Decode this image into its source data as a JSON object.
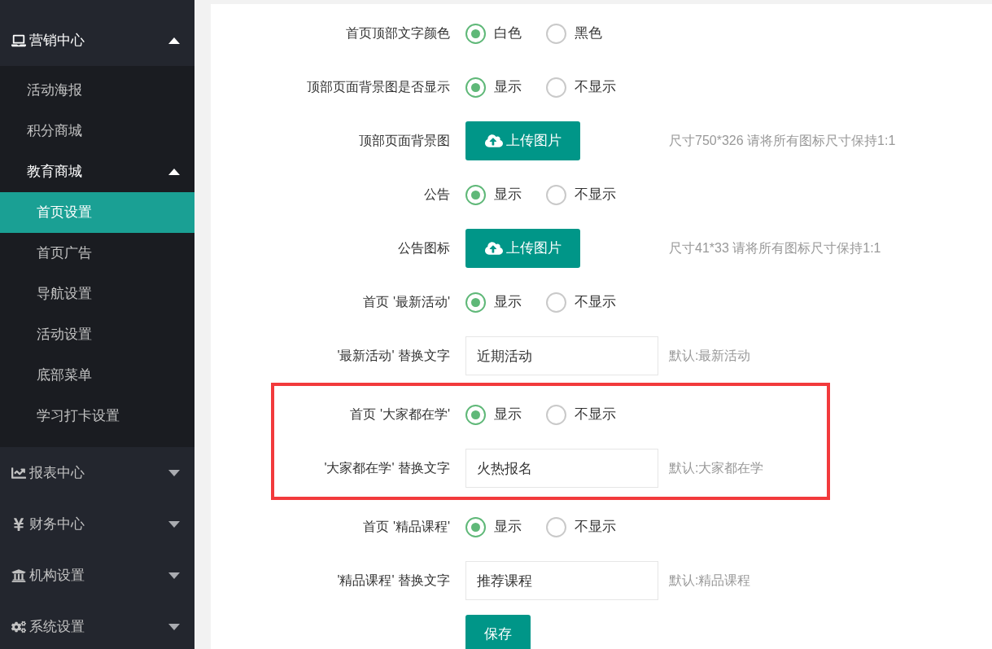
{
  "sidebar": {
    "menus": [
      {
        "label": "营销中心",
        "expanded": true,
        "children": [
          {
            "label": "活动海报",
            "selected": false
          },
          {
            "label": "积分商城",
            "selected": false
          },
          {
            "label": "教育商城",
            "selected": false,
            "expanded": true,
            "children": [
              {
                "label": "首页设置",
                "selected": true
              },
              {
                "label": "首页广告",
                "selected": false
              },
              {
                "label": "导航设置",
                "selected": false
              },
              {
                "label": "活动设置",
                "selected": false
              },
              {
                "label": "底部菜单",
                "selected": false
              },
              {
                "label": "学习打卡设置",
                "selected": false
              }
            ]
          }
        ]
      },
      {
        "label": "报表中心",
        "expanded": false
      },
      {
        "label": "财务中心",
        "expanded": false
      },
      {
        "label": "机构设置",
        "expanded": false
      },
      {
        "label": "系统设置",
        "expanded": false
      }
    ]
  },
  "form": {
    "rows": [
      {
        "kind": "radio",
        "label": "首页顶部文字颜色",
        "highlighted": false,
        "options": [
          {
            "label": "白色",
            "selected": true
          },
          {
            "label": "黑色",
            "selected": false
          }
        ]
      },
      {
        "kind": "radio",
        "label": "顶部页面背景图是否显示",
        "highlighted": false,
        "options": [
          {
            "label": "显示",
            "selected": true
          },
          {
            "label": "不显示",
            "selected": false
          }
        ]
      },
      {
        "kind": "upload",
        "label": "顶部页面背景图",
        "highlighted": false,
        "button": "上传图片",
        "hint": "尺寸750*326 请将所有图标尺寸保持1:1"
      },
      {
        "kind": "radio",
        "label": "公告",
        "highlighted": false,
        "options": [
          {
            "label": "显示",
            "selected": true
          },
          {
            "label": "不显示",
            "selected": false
          }
        ]
      },
      {
        "kind": "upload",
        "label": "公告图标",
        "highlighted": false,
        "button": "上传图片",
        "hint": "尺寸41*33 请将所有图标尺寸保持1:1"
      },
      {
        "kind": "radio",
        "label": "首页 '最新活动'",
        "highlighted": false,
        "options": [
          {
            "label": "显示",
            "selected": true
          },
          {
            "label": "不显示",
            "selected": false
          }
        ]
      },
      {
        "kind": "text",
        "label": "'最新活动' 替换文字",
        "highlighted": false,
        "value": "近期活动",
        "hint": "默认:最新活动"
      },
      {
        "kind": "radio",
        "label": "首页 '大家都在学'",
        "highlighted": true,
        "options": [
          {
            "label": "显示",
            "selected": true
          },
          {
            "label": "不显示",
            "selected": false
          }
        ]
      },
      {
        "kind": "text",
        "label": "'大家都在学' 替换文字",
        "highlighted": true,
        "value": "火热报名",
        "hint": "默认:大家都在学"
      },
      {
        "kind": "radio",
        "label": "首页 '精品课程'",
        "highlighted": false,
        "options": [
          {
            "label": "显示",
            "selected": true
          },
          {
            "label": "不显示",
            "selected": false
          }
        ]
      },
      {
        "kind": "text",
        "label": "'精品课程' 替换文字",
        "highlighted": false,
        "value": "推荐课程",
        "hint": "默认:精品课程"
      },
      {
        "kind": "submit",
        "label": "",
        "highlighted": false,
        "button": "保存"
      }
    ]
  }
}
